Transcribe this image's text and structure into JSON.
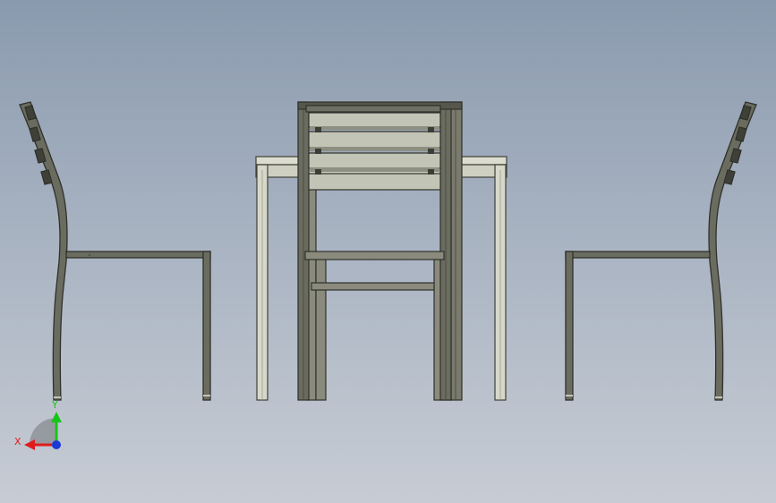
{
  "viewport": {
    "background_top": "#8a9aae",
    "background_bottom": "#c7ccd4"
  },
  "model": {
    "objects": [
      "side-chair-left",
      "table",
      "front-chair",
      "side-chair-right"
    ],
    "frame_color": "#3f4138",
    "frame_fill": "#6b6c60",
    "slat_fill": "#c2c4b6",
    "table_fill": "#d7d8ca"
  },
  "triad": {
    "x_label": "X",
    "y_label": "Y",
    "x_color": "#e01c1c",
    "y_color": "#17c41a",
    "z_color": "#1a3ad6",
    "icon": "coordinate-triad-icon"
  }
}
